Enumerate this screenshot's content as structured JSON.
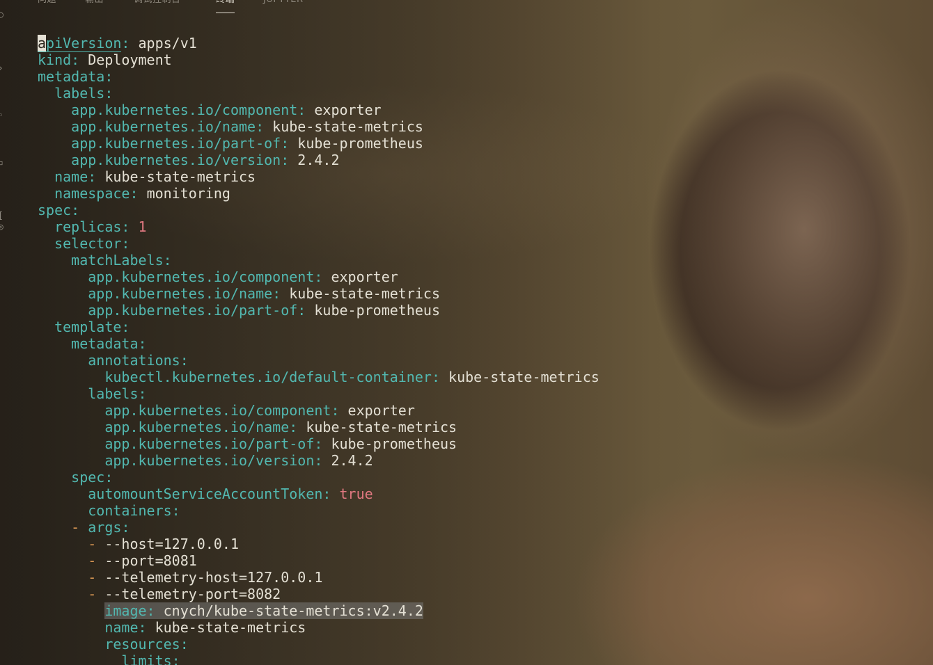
{
  "panel": {
    "tabs": [
      {
        "label": "问题",
        "active": false
      },
      {
        "label": "输出",
        "active": false
      },
      {
        "label": "调试控制台",
        "active": false
      },
      {
        "label": "终端",
        "active": true
      },
      {
        "label": "JUPYTER",
        "active": false
      }
    ]
  },
  "colors": {
    "key": "#52b8b0",
    "value": "#e4e0d4",
    "number": "#e07880",
    "dash": "#d79653"
  },
  "editor": {
    "cursor_line": 1,
    "highlighted_line": 35,
    "lines": [
      {
        "indent": 0,
        "dash": false,
        "key": "apiVersion",
        "value": "apps/v1",
        "vtype": "str"
      },
      {
        "indent": 0,
        "dash": false,
        "key": "kind",
        "value": "Deployment",
        "vtype": "str"
      },
      {
        "indent": 0,
        "dash": false,
        "key": "metadata",
        "value": "",
        "vtype": "none"
      },
      {
        "indent": 1,
        "dash": false,
        "key": "labels",
        "value": "",
        "vtype": "none"
      },
      {
        "indent": 2,
        "dash": false,
        "key": "app.kubernetes.io/component",
        "value": "exporter",
        "vtype": "str"
      },
      {
        "indent": 2,
        "dash": false,
        "key": "app.kubernetes.io/name",
        "value": "kube-state-metrics",
        "vtype": "str"
      },
      {
        "indent": 2,
        "dash": false,
        "key": "app.kubernetes.io/part-of",
        "value": "kube-prometheus",
        "vtype": "str"
      },
      {
        "indent": 2,
        "dash": false,
        "key": "app.kubernetes.io/version",
        "value": "2.4.2",
        "vtype": "str"
      },
      {
        "indent": 1,
        "dash": false,
        "key": "name",
        "value": "kube-state-metrics",
        "vtype": "str"
      },
      {
        "indent": 1,
        "dash": false,
        "key": "namespace",
        "value": "monitoring",
        "vtype": "str"
      },
      {
        "indent": 0,
        "dash": false,
        "key": "spec",
        "value": "",
        "vtype": "none"
      },
      {
        "indent": 1,
        "dash": false,
        "key": "replicas",
        "value": "1",
        "vtype": "num"
      },
      {
        "indent": 1,
        "dash": false,
        "key": "selector",
        "value": "",
        "vtype": "none"
      },
      {
        "indent": 2,
        "dash": false,
        "key": "matchLabels",
        "value": "",
        "vtype": "none"
      },
      {
        "indent": 3,
        "dash": false,
        "key": "app.kubernetes.io/component",
        "value": "exporter",
        "vtype": "str"
      },
      {
        "indent": 3,
        "dash": false,
        "key": "app.kubernetes.io/name",
        "value": "kube-state-metrics",
        "vtype": "str"
      },
      {
        "indent": 3,
        "dash": false,
        "key": "app.kubernetes.io/part-of",
        "value": "kube-prometheus",
        "vtype": "str"
      },
      {
        "indent": 1,
        "dash": false,
        "key": "template",
        "value": "",
        "vtype": "none"
      },
      {
        "indent": 2,
        "dash": false,
        "key": "metadata",
        "value": "",
        "vtype": "none"
      },
      {
        "indent": 3,
        "dash": false,
        "key": "annotations",
        "value": "",
        "vtype": "none"
      },
      {
        "indent": 4,
        "dash": false,
        "key": "kubectl.kubernetes.io/default-container",
        "value": "kube-state-metrics",
        "vtype": "str"
      },
      {
        "indent": 3,
        "dash": false,
        "key": "labels",
        "value": "",
        "vtype": "none"
      },
      {
        "indent": 4,
        "dash": false,
        "key": "app.kubernetes.io/component",
        "value": "exporter",
        "vtype": "str"
      },
      {
        "indent": 4,
        "dash": false,
        "key": "app.kubernetes.io/name",
        "value": "kube-state-metrics",
        "vtype": "str"
      },
      {
        "indent": 4,
        "dash": false,
        "key": "app.kubernetes.io/part-of",
        "value": "kube-prometheus",
        "vtype": "str"
      },
      {
        "indent": 4,
        "dash": false,
        "key": "app.kubernetes.io/version",
        "value": "2.4.2",
        "vtype": "str"
      },
      {
        "indent": 2,
        "dash": false,
        "key": "spec",
        "value": "",
        "vtype": "none"
      },
      {
        "indent": 3,
        "dash": false,
        "key": "automountServiceAccountToken",
        "value": "true",
        "vtype": "bool"
      },
      {
        "indent": 3,
        "dash": false,
        "key": "containers",
        "value": "",
        "vtype": "none"
      },
      {
        "indent": 3,
        "dash": true,
        "key": "args",
        "value": "",
        "vtype": "none"
      },
      {
        "indent": 4,
        "dash": true,
        "key": "",
        "value": "--host=127.0.0.1",
        "vtype": "str"
      },
      {
        "indent": 4,
        "dash": true,
        "key": "",
        "value": "--port=8081",
        "vtype": "str"
      },
      {
        "indent": 4,
        "dash": true,
        "key": "",
        "value": "--telemetry-host=127.0.0.1",
        "vtype": "str"
      },
      {
        "indent": 4,
        "dash": true,
        "key": "",
        "value": "--telemetry-port=8082",
        "vtype": "str"
      },
      {
        "indent": 4,
        "dash": false,
        "key": "image",
        "value": "cnych/kube-state-metrics:v2.4.2",
        "vtype": "str"
      },
      {
        "indent": 4,
        "dash": false,
        "key": "name",
        "value": "kube-state-metrics",
        "vtype": "str"
      },
      {
        "indent": 4,
        "dash": false,
        "key": "resources",
        "value": "",
        "vtype": "none"
      },
      {
        "indent": 5,
        "dash": false,
        "key": "limits",
        "value": "",
        "vtype": "none"
      }
    ]
  }
}
